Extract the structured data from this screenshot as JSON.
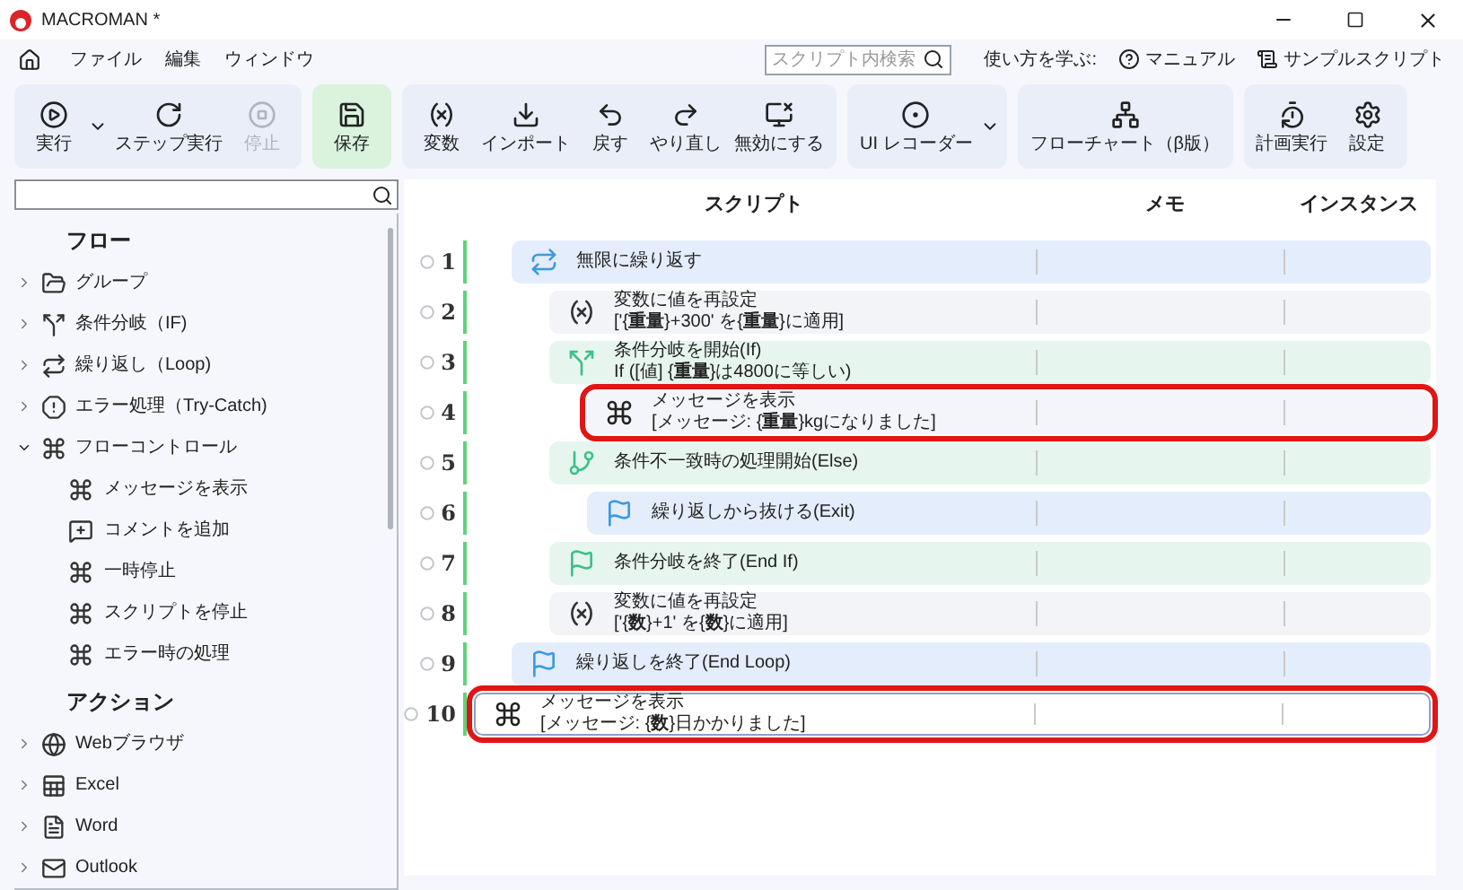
{
  "window": {
    "title": "MACROMAN *"
  },
  "menu": [
    "ファイル",
    "編集",
    "ウィンドウ"
  ],
  "search": {
    "placeholder": "スクリプト内検索"
  },
  "help": {
    "label": "使い方を学ぶ:",
    "links": [
      {
        "label": "マニュアル",
        "kind": "help"
      },
      {
        "label": "サンプルスクリプト",
        "kind": "sample"
      }
    ]
  },
  "toolbar": [
    {
      "kind": "normal",
      "items": [
        {
          "label": "実行",
          "kind": "run",
          "disabled": false,
          "dropdown": true
        },
        {
          "label": "ステップ実行",
          "kind": "step",
          "disabled": false,
          "dropdown": false
        },
        {
          "label": "停止",
          "kind": "stop",
          "disabled": true,
          "dropdown": false
        }
      ]
    },
    {
      "kind": "save",
      "items": [
        {
          "label": "保存",
          "kind": "save",
          "disabled": false,
          "dropdown": false
        }
      ]
    },
    {
      "kind": "normal",
      "items": [
        {
          "label": "変数",
          "kind": "variable",
          "disabled": false,
          "dropdown": false
        },
        {
          "label": "インポート",
          "kind": "import",
          "disabled": false,
          "dropdown": false
        },
        {
          "label": "戻す",
          "kind": "undo",
          "disabled": false,
          "dropdown": false
        },
        {
          "label": "やり直し",
          "kind": "redo",
          "disabled": false,
          "dropdown": false
        },
        {
          "label": "無効にする",
          "kind": "disable",
          "disabled": false,
          "dropdown": false
        }
      ]
    },
    {
      "kind": "normal",
      "items": [
        {
          "label": "UI レコーダー",
          "kind": "record",
          "disabled": false,
          "dropdown": true
        }
      ]
    },
    {
      "kind": "normal",
      "items": [
        {
          "label": "フローチャート（β版）",
          "kind": "flowchart",
          "disabled": false,
          "dropdown": false
        }
      ]
    },
    {
      "kind": "normal",
      "items": [
        {
          "label": "計画実行",
          "kind": "schedule",
          "disabled": false,
          "dropdown": false
        },
        {
          "label": "設定",
          "kind": "settings",
          "disabled": false,
          "dropdown": false
        }
      ]
    }
  ],
  "sidebar": {
    "sections": [
      {
        "title": "フロー",
        "items": [
          {
            "label": "グループ",
            "kind": "group",
            "expanded": false
          },
          {
            "label": "条件分岐（IF)",
            "kind": "if",
            "expanded": false
          },
          {
            "label": "繰り返し（Loop)",
            "kind": "loop",
            "expanded": false
          },
          {
            "label": "エラー処理（Try-Catch)",
            "kind": "error",
            "expanded": false
          },
          {
            "label": "フローコントロール",
            "kind": "command",
            "expanded": true,
            "children": [
              {
                "label": "メッセージを表示",
                "kind": "command"
              },
              {
                "label": "コメントを追加",
                "kind": "comment"
              },
              {
                "label": "一時停止",
                "kind": "command"
              },
              {
                "label": "スクリプトを停止",
                "kind": "command"
              },
              {
                "label": "エラー時の処理",
                "kind": "command"
              }
            ]
          }
        ]
      },
      {
        "title": "アクション",
        "items": [
          {
            "label": "Webブラウザ",
            "kind": "web",
            "expanded": false
          },
          {
            "label": "Excel",
            "kind": "excel",
            "expanded": false
          },
          {
            "label": "Word",
            "kind": "word",
            "expanded": false
          },
          {
            "label": "Outlook",
            "kind": "outlook",
            "expanded": false
          }
        ]
      }
    ]
  },
  "script": {
    "columns": [
      "スクリプト",
      "メモ",
      "インスタンス"
    ],
    "rows": [
      {
        "number": "1",
        "kind": "loop",
        "title": "無限に繰り返す",
        "selected": false,
        "highlighted": false,
        "children": [
          {
            "number": "2",
            "kind": "variable",
            "title": "変数に値を再設定",
            "detail": "['{**重量**}+300' を{**重量**}に適用]",
            "selected": false,
            "highlighted": false
          },
          {
            "number": "3",
            "kind": "if",
            "title": "条件分岐を開始(If)",
            "detail": "If ([値] {**重量**}は4800に等しい)",
            "selected": false,
            "highlighted": false,
            "children": [
              {
                "number": "4",
                "kind": "message",
                "title": "メッセージを表示",
                "detail": "[メッセージ: {**重量**}kgになりました]",
                "selected": false,
                "highlighted": true
              }
            ]
          },
          {
            "number": "5",
            "kind": "else",
            "title": "条件不一致時の処理開始(Else)",
            "selected": false,
            "highlighted": false,
            "children": [
              {
                "number": "6",
                "kind": "exit",
                "title": "繰り返しから抜ける(Exit)",
                "selected": false,
                "highlighted": false
              }
            ]
          },
          {
            "number": "7",
            "kind": "endif",
            "title": "条件分岐を終了(End If)",
            "selected": false,
            "highlighted": false
          },
          {
            "number": "8",
            "kind": "variable",
            "title": "変数に値を再設定",
            "detail": "['{**数**}+1' を{**数**}に適用]",
            "selected": false,
            "highlighted": false
          }
        ]
      },
      {
        "number": "9",
        "kind": "endloop",
        "title": "繰り返しを終了(End Loop)",
        "selected": false,
        "highlighted": false
      },
      {
        "number": "10",
        "kind": "message",
        "title": "メッセージを表示",
        "detail": "[メッセージ: {**数**}日かかりました]",
        "selected": true,
        "highlighted": true
      }
    ]
  }
}
